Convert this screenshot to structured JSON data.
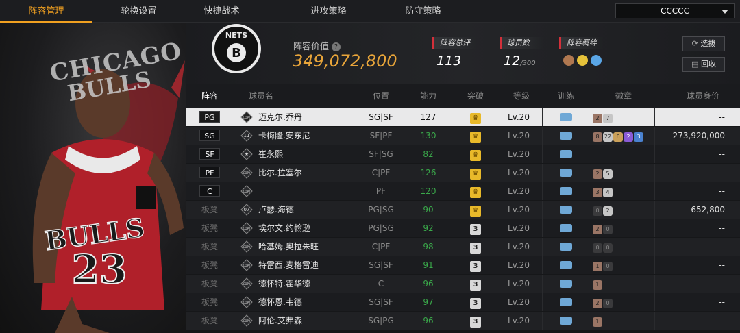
{
  "nav": {
    "tabs": [
      "阵容管理",
      "轮换设置",
      "快捷战术",
      "进攻策略",
      "防守策略"
    ],
    "active_tab": 0,
    "team_select": "CCCCC"
  },
  "art": {
    "logo_line1": "CHICAGO",
    "logo_line2": "BULLS"
  },
  "header": {
    "value_label": "阵容价值",
    "value": "349,072,800",
    "stats": {
      "overall_label": "阵容总评",
      "overall": "113",
      "count_label": "球员数",
      "count": "12",
      "count_max": "/300",
      "chem_label": "阵容羁绊"
    },
    "buttons": {
      "select": "选拔",
      "recycle": "回收"
    }
  },
  "table": {
    "headers": [
      "阵容",
      "球员名",
      "位置",
      "能力",
      "突破",
      "等级",
      "训练",
      "徽章",
      "球员身价"
    ],
    "rows": [
      {
        "slot": "PG",
        "name": "迈克尔.乔丹",
        "pos": "SG|SF",
        "rating": "127",
        "bt": "gold",
        "level": "Lv.20",
        "badges": [
          [
            "bronze",
            "2"
          ],
          [
            "silver",
            "7"
          ]
        ],
        "salary": "--",
        "selected": true,
        "icon": "COPY"
      },
      {
        "slot": "SG",
        "name": "卡梅隆.安东尼",
        "pos": "SF|PF",
        "rating": "130",
        "bt": "gold",
        "level": "Lv.20",
        "badges": [
          [
            "bronze",
            "8"
          ],
          [
            "silver",
            "22"
          ],
          [
            "gold",
            "6"
          ],
          [
            "purple",
            "2"
          ],
          [
            "blue",
            "3"
          ]
        ],
        "salary": "273,920,000",
        "icon": "11"
      },
      {
        "slot": "SF",
        "name": "崔永熙",
        "pos": "SF|SG",
        "rating": "82",
        "bt": "gold",
        "level": "Lv.20",
        "badges": [],
        "salary": "--",
        "icon": "★"
      },
      {
        "slot": "PF",
        "name": "比尔.拉塞尔",
        "pos": "C|PF",
        "rating": "126",
        "bt": "gold",
        "level": "Lv.20",
        "badges": [
          [
            "bronze",
            "2"
          ],
          [
            "silver",
            "5"
          ]
        ],
        "salary": "--",
        "icon": "COPY"
      },
      {
        "slot": "C",
        "name": "",
        "pos": "PF",
        "rating": "120",
        "bt": "gold",
        "level": "Lv.20",
        "badges": [
          [
            "bronze",
            "3"
          ],
          [
            "silver",
            "4"
          ]
        ],
        "salary": "--",
        "icon": "COPY"
      },
      {
        "slot": "板凳",
        "name": "卢瑟.海德",
        "pos": "PG|SG",
        "rating": "90",
        "bt": "gold",
        "level": "Lv.20",
        "badges": [
          [
            "dark",
            "0"
          ],
          [
            "silver",
            "2"
          ]
        ],
        "salary": "652,800",
        "icon": "07"
      },
      {
        "slot": "板凳",
        "name": "埃尔文.约翰逊",
        "pos": "PG|SG",
        "rating": "92",
        "bt": "gray",
        "level": "Lv.20",
        "badges": [
          [
            "bronze",
            "2"
          ],
          [
            "dark",
            "0"
          ]
        ],
        "salary": "--",
        "icon": "COPY"
      },
      {
        "slot": "板凳",
        "name": "哈基姆.奥拉朱旺",
        "pos": "C|PF",
        "rating": "98",
        "bt": "gray",
        "level": "Lv.20",
        "badges": [
          [
            "dark",
            "0"
          ],
          [
            "dark",
            "0"
          ]
        ],
        "salary": "--",
        "icon": "COPY"
      },
      {
        "slot": "板凳",
        "name": "特雷西.麦格雷迪",
        "pos": "SG|SF",
        "rating": "91",
        "bt": "gray",
        "level": "Lv.20",
        "badges": [
          [
            "bronze",
            "1"
          ],
          [
            "dark",
            "0"
          ]
        ],
        "salary": "--",
        "icon": "COPY"
      },
      {
        "slot": "板凳",
        "name": "德怀特.霍华德",
        "pos": "C",
        "rating": "96",
        "bt": "gray",
        "level": "Lv.20",
        "badges": [
          [
            "bronze",
            "1"
          ]
        ],
        "salary": "--",
        "icon": "COPY"
      },
      {
        "slot": "板凳",
        "name": "德怀恩.韦德",
        "pos": "SG|SF",
        "rating": "97",
        "bt": "gray",
        "level": "Lv.20",
        "badges": [
          [
            "bronze",
            "2"
          ],
          [
            "dark",
            "0"
          ]
        ],
        "salary": "--",
        "icon": "COPY"
      },
      {
        "slot": "板凳",
        "name": "阿伦.艾弗森",
        "pos": "SG|PG",
        "rating": "96",
        "bt": "gray",
        "level": "Lv.20",
        "badges": [
          [
            "bronze",
            "1"
          ]
        ],
        "salary": "--",
        "icon": "COPY"
      }
    ],
    "breakthrough_gray_label": "3"
  },
  "colors": {
    "accent": "#f0a020",
    "value": "#e8a53a",
    "rating_green": "#3aa84a",
    "stat_red": "#d3303a"
  }
}
